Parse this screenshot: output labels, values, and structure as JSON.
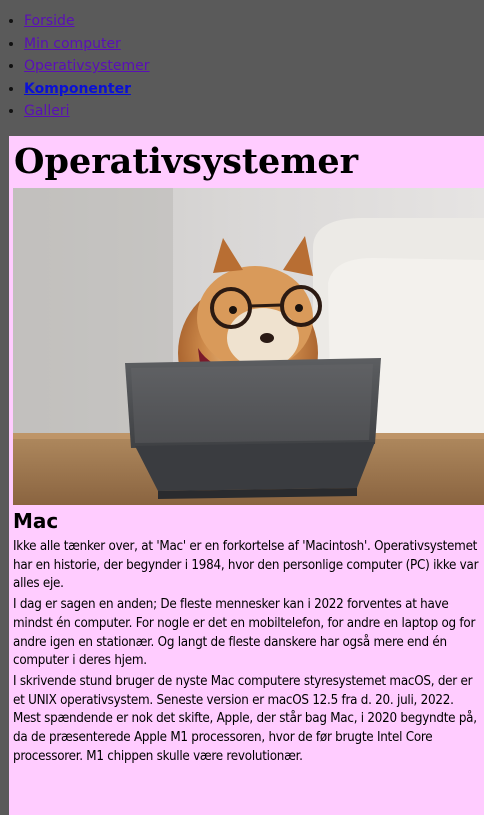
{
  "nav": {
    "items": [
      {
        "label": "Forside"
      },
      {
        "label": "Min computer"
      },
      {
        "label": "Operativsystemer"
      },
      {
        "label": "Komponenter"
      },
      {
        "label": "Galleri"
      }
    ]
  },
  "main": {
    "title": "Operativsystemer",
    "section_heading": "Mac",
    "paragraphs": [
      "Ikke alle tænker over, at 'Mac' er en forkortelse af 'Macintosh'. Operativsystemet har en historie, der begynder i 1984, hvor den personlige computer (PC) ikke var alles eje.",
      "I dag er sagen en anden; De fleste mennesker kan i 2022 forventes at have mindst én computer. For nogle er det en mobiltelefon, for andre en laptop og for andre igen en stationær. Og langt de fleste danskere har også mere end én computer i deres hjem.",
      "I skrivende stund bruger de nyste Mac computere styresystemet macOS, der er et UNIX operativsystem. Seneste version er macOS 12.5 fra d. 20. juli, 2022. Mest spændende er nok det skifte, Apple, der står bag Mac, i 2020 begyndte på, da de præsenterede Apple M1 processoren, hvor de før brugte Intel Core processorer. M1 chippen skulle være revolutionær."
    ]
  }
}
